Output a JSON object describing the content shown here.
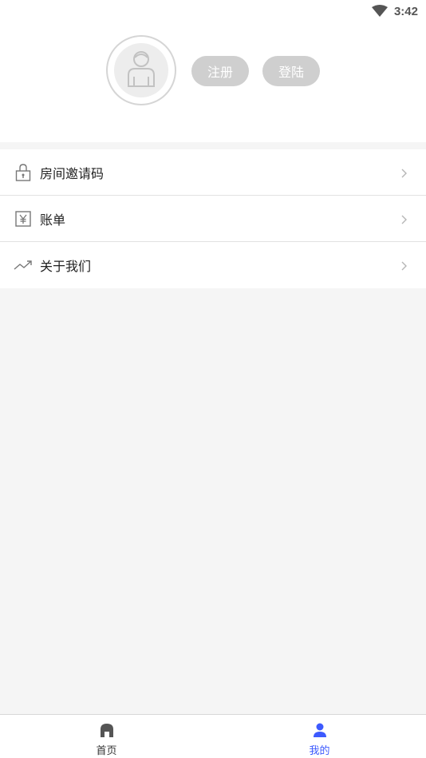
{
  "status_bar": {
    "time": "3:42",
    "wifi_icon": "wifi-icon"
  },
  "profile": {
    "avatar_icon": "user-avatar-icon",
    "register_label": "注册",
    "login_label": "登陆"
  },
  "menu": {
    "items": [
      {
        "label": "房间邀请码",
        "icon": "lock-icon"
      },
      {
        "label": "账单",
        "icon": "yen-bill-icon"
      },
      {
        "label": "关于我们",
        "icon": "trend-icon"
      }
    ]
  },
  "tabbar": {
    "tabs": [
      {
        "label": "首页",
        "icon": "home-icon",
        "active": false
      },
      {
        "label": "我的",
        "icon": "person-icon",
        "active": true
      }
    ],
    "active_color": "#3d5afe",
    "inactive_color": "#333333"
  },
  "colors": {
    "button_bg": "#cfcfcf",
    "page_bg": "#f5f5f5"
  }
}
